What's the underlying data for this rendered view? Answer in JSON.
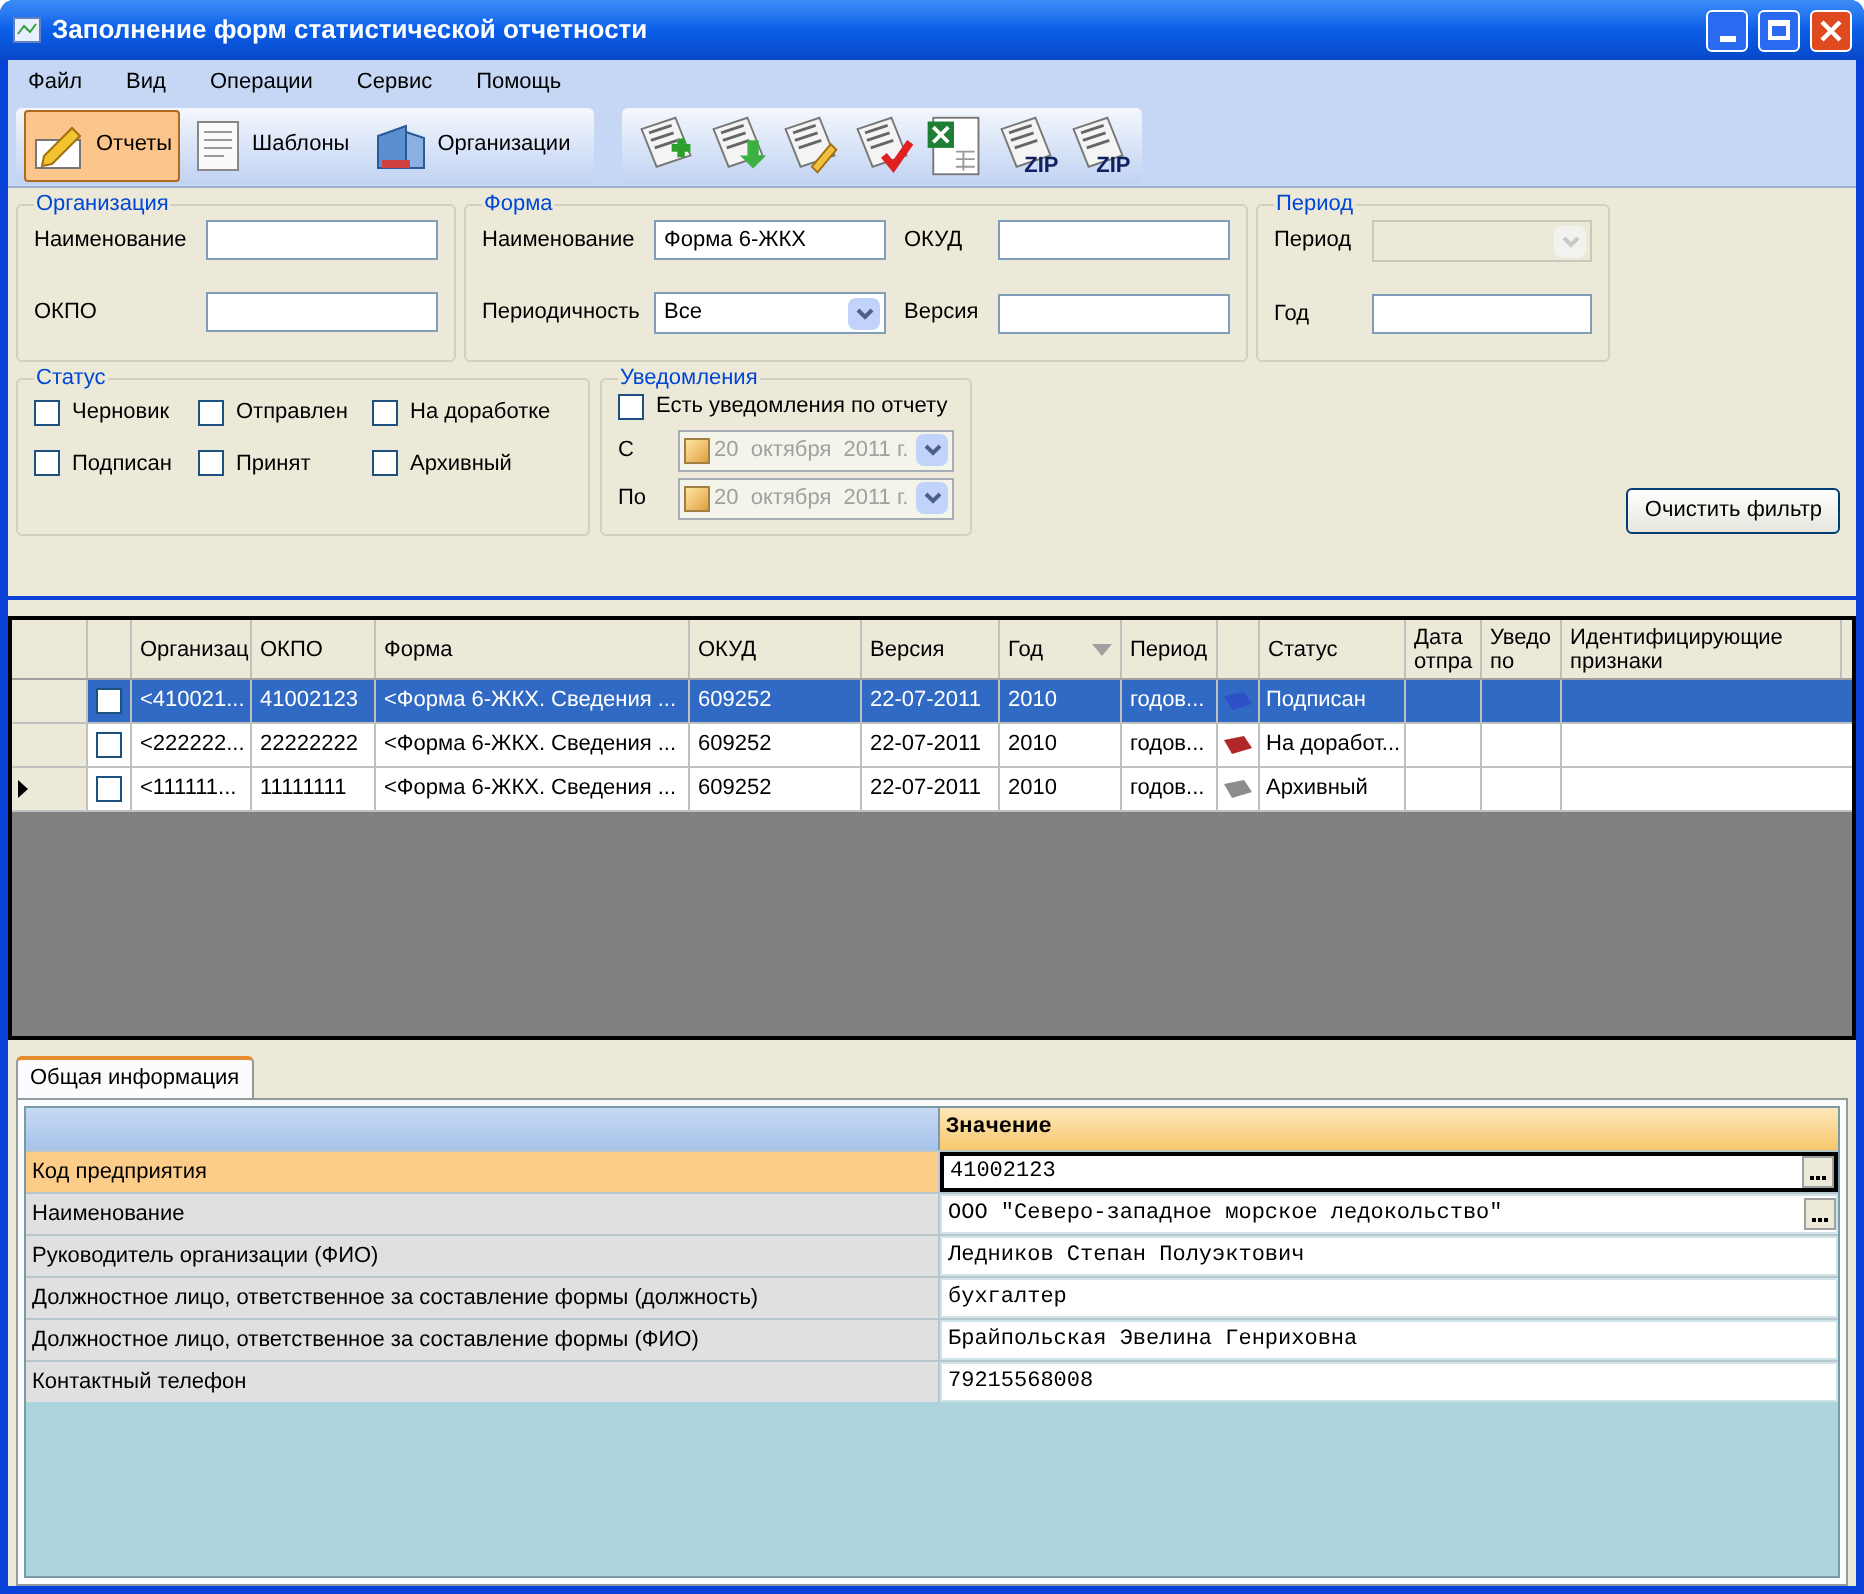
{
  "window": {
    "title": "Заполнение форм статистической отчетности"
  },
  "menu": [
    "Файл",
    "Вид",
    "Операции",
    "Сервис",
    "Помощь"
  ],
  "toolbar": {
    "buttons": [
      {
        "kind": "pencil",
        "label": "Отчеты",
        "selected": true
      },
      {
        "kind": "document",
        "label": "Шаблоны",
        "selected": false
      },
      {
        "kind": "building",
        "label": "Организации",
        "selected": false
      }
    ],
    "icons": [
      {
        "kind": "add"
      },
      {
        "kind": "import"
      },
      {
        "kind": "edit"
      },
      {
        "kind": "check"
      },
      {
        "kind": "excel"
      },
      {
        "kind": "zip",
        "badge": "ZIP"
      },
      {
        "kind": "zip",
        "badge": "ZIP"
      }
    ]
  },
  "filters": {
    "organization": {
      "title": "Организация",
      "fields": [
        {
          "label": "Наименование"
        },
        {
          "label": "ОКПО"
        }
      ]
    },
    "form": {
      "title": "Форма",
      "fields": [
        {
          "label": "Наименование",
          "value": "Форма 6-ЖКХ",
          "kind": "text"
        },
        {
          "label": "ОКУД",
          "kind": "text"
        },
        {
          "label": "Периодичность",
          "value": "Все",
          "kind": "select"
        },
        {
          "label": "Версия",
          "kind": "text"
        }
      ]
    },
    "period": {
      "title": "Период",
      "fields": [
        {
          "label": "Период",
          "kind": "select",
          "disabled": true
        },
        {
          "label": "Год",
          "kind": "text",
          "disabled": false
        }
      ]
    },
    "status": {
      "title": "Статус",
      "options": [
        {
          "label": "Черновик",
          "checked": false
        },
        {
          "label": "Отправлен",
          "checked": false
        },
        {
          "label": "На доработке",
          "checked": false
        },
        {
          "label": "Подписан",
          "checked": false
        },
        {
          "label": "Принят",
          "checked": false
        },
        {
          "label": "Архивный",
          "checked": false
        }
      ]
    },
    "notifications": {
      "title": "Уведомления",
      "option": {
        "label": "Есть уведомления по отчету",
        "checked": false
      },
      "dates": [
        {
          "label": "С",
          "value": "20  октября  2011 г.",
          "disabled": true
        },
        {
          "label": "По",
          "value": "20  октября  2011 г.",
          "disabled": true
        }
      ]
    },
    "clear_button": "Очистить фильтр"
  },
  "table": {
    "columns": [
      {
        "label": "Организац"
      },
      {
        "label": "ОКПО"
      },
      {
        "label": "Форма"
      },
      {
        "label": "ОКУД"
      },
      {
        "label": "Версия"
      },
      {
        "label": "Год",
        "sorted": true
      },
      {
        "label": "Период"
      },
      {
        "label": "Статус"
      },
      {
        "label": "Дата отпра"
      },
      {
        "label": "Уведо по"
      },
      {
        "label": "Идентифицирующие признаки"
      }
    ],
    "rows": [
      {
        "selected": true,
        "current": false,
        "checked": false,
        "cells": [
          "<410021...",
          "41002123",
          "<Форма 6-ЖКХ. Сведения ...",
          "609252",
          "22-07-2011",
          "2010",
          "годов..."
        ],
        "color": "#3050c8",
        "status": "Подписан"
      },
      {
        "selected": false,
        "current": false,
        "checked": false,
        "cells": [
          "<222222...",
          "22222222",
          "<Форма 6-ЖКХ. Сведения ...",
          "609252",
          "22-07-2011",
          "2010",
          "годов..."
        ],
        "color": "#b02828",
        "status": "На доработ..."
      },
      {
        "selected": false,
        "current": true,
        "checked": false,
        "cells": [
          "<111111...",
          "11111111",
          "<Форма 6-ЖКХ. Сведения ...",
          "609252",
          "22-07-2011",
          "2010",
          "годов..."
        ],
        "color": "#8c8c8c",
        "status": "Архивный"
      }
    ]
  },
  "tabs": [
    {
      "label": "Общая информация",
      "selected": true
    }
  ],
  "properties": {
    "header": "Значение",
    "rows": [
      {
        "name": "Код предприятия",
        "value": "41002123",
        "selected": true,
        "has_button": true
      },
      {
        "name": "Наименование",
        "value": "ООО \"Северо-западное морское ледокольство\"",
        "selected": false,
        "has_button": true
      },
      {
        "name": "Руководитель организации (ФИО)",
        "value": "Ледников Степан Полуэктович",
        "selected": false,
        "has_button": false
      },
      {
        "name": "Должностное лицо, ответственное за составление формы (должность)",
        "value": "бухгалтер",
        "selected": false,
        "has_button": false
      },
      {
        "name": "Должностное лицо, ответственное за составление формы (ФИО)",
        "value": "Брайпольская Эвелина Генриховна",
        "selected": false,
        "has_button": false
      },
      {
        "name": "Контактный телефон",
        "value": "79215568008",
        "selected": false,
        "has_button": false
      }
    ]
  }
}
